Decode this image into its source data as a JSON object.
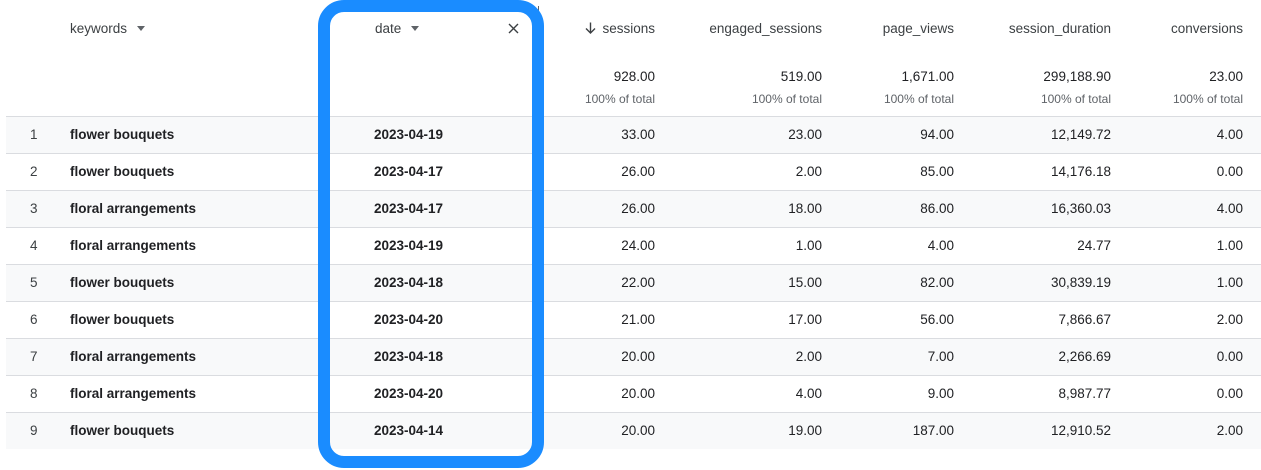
{
  "header": {
    "keywords": "keywords",
    "date": "date",
    "sessions": "sessions",
    "engaged_sessions": "engaged_sessions",
    "page_views": "page_views",
    "session_duration": "session_duration",
    "conversions": "conversions"
  },
  "totals": {
    "sessions": "928.00",
    "engaged_sessions": "519.00",
    "page_views": "1,671.00",
    "session_duration": "299,188.90",
    "conversions": "23.00",
    "pct_label": "100% of total"
  },
  "rows": [
    {
      "idx": "1",
      "keyword": "flower bouquets",
      "date": "2023-04-19",
      "sessions": "33.00",
      "engaged": "23.00",
      "views": "94.00",
      "duration": "12,149.72",
      "conv": "4.00"
    },
    {
      "idx": "2",
      "keyword": "flower bouquets",
      "date": "2023-04-17",
      "sessions": "26.00",
      "engaged": "2.00",
      "views": "85.00",
      "duration": "14,176.18",
      "conv": "0.00"
    },
    {
      "idx": "3",
      "keyword": "floral arrangements",
      "date": "2023-04-17",
      "sessions": "26.00",
      "engaged": "18.00",
      "views": "86.00",
      "duration": "16,360.03",
      "conv": "4.00"
    },
    {
      "idx": "4",
      "keyword": "floral arrangements",
      "date": "2023-04-19",
      "sessions": "24.00",
      "engaged": "1.00",
      "views": "4.00",
      "duration": "24.77",
      "conv": "1.00"
    },
    {
      "idx": "5",
      "keyword": "flower bouquets",
      "date": "2023-04-18",
      "sessions": "22.00",
      "engaged": "15.00",
      "views": "82.00",
      "duration": "30,839.19",
      "conv": "1.00"
    },
    {
      "idx": "6",
      "keyword": "flower bouquets",
      "date": "2023-04-20",
      "sessions": "21.00",
      "engaged": "17.00",
      "views": "56.00",
      "duration": "7,866.67",
      "conv": "2.00"
    },
    {
      "idx": "7",
      "keyword": "floral arrangements",
      "date": "2023-04-18",
      "sessions": "20.00",
      "engaged": "2.00",
      "views": "7.00",
      "duration": "2,266.69",
      "conv": "0.00"
    },
    {
      "idx": "8",
      "keyword": "floral arrangements",
      "date": "2023-04-20",
      "sessions": "20.00",
      "engaged": "4.00",
      "views": "9.00",
      "duration": "8,987.77",
      "conv": "0.00"
    },
    {
      "idx": "9",
      "keyword": "flower bouquets",
      "date": "2023-04-14",
      "sessions": "20.00",
      "engaged": "19.00",
      "views": "187.00",
      "duration": "12,910.52",
      "conv": "2.00"
    }
  ],
  "colors": {
    "highlight": "#1a8cff",
    "row_shade": "#f8f9fa",
    "divider": "#dadce0"
  },
  "icons": {
    "sort": "arrow-down-icon",
    "dropdown": "caret-down-icon",
    "remove": "close-icon"
  }
}
